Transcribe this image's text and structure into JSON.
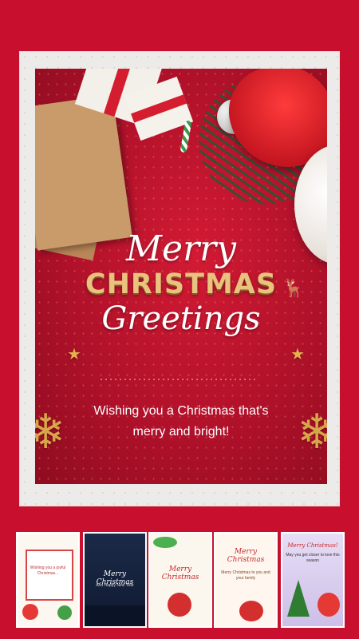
{
  "card": {
    "title_line1": "Merry",
    "title_line2": "CHRISTMAS",
    "title_line3": "Greetings",
    "wish_line1": "Wishing you a Christmas that's",
    "wish_line2": "merry and bright!"
  },
  "colors": {
    "background": "#c8102e",
    "card_red": "#b0112a",
    "gold": "#e9c27d",
    "frame": "#ecebea"
  },
  "thumbnails": [
    {
      "name": "template-1",
      "title": "",
      "subtitle": "Wishing you a joyful Christmas..."
    },
    {
      "name": "template-2",
      "title": "Merry Christmas",
      "subtitle": "And Happy New Year"
    },
    {
      "name": "template-3",
      "title": "Merry Christmas",
      "subtitle": ""
    },
    {
      "name": "template-4",
      "title": "Merry Christmas",
      "subtitle": "Merry Christmas to you and your family"
    },
    {
      "name": "template-5",
      "title": "Merry Christmas!",
      "subtitle": "May you get closer to love this season"
    }
  ]
}
